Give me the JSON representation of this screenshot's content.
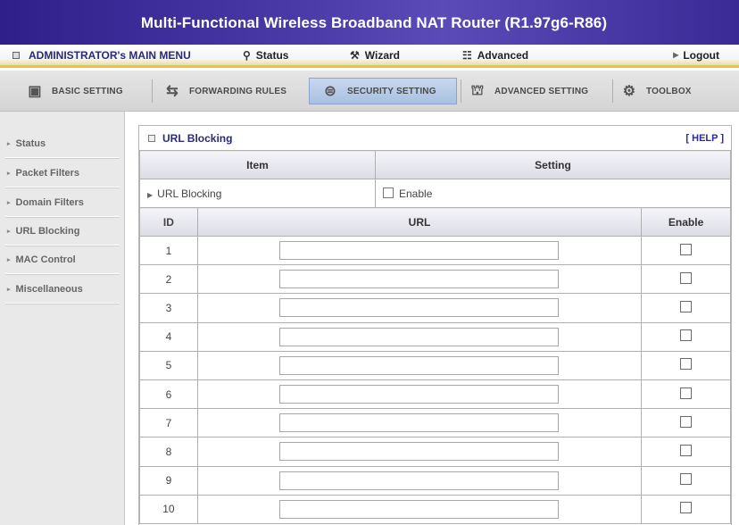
{
  "header": {
    "title": "Multi-Functional Wireless Broadband NAT Router (R1.97g6-R86)"
  },
  "main_menu": {
    "admin_label": "ADMINISTRATOR's MAIN MENU",
    "status_label": "Status",
    "wizard_label": "Wizard",
    "advanced_label": "Advanced",
    "logout_label": "Logout"
  },
  "tabs": {
    "basic": "BASIC SETTING",
    "forwarding": "FORWARDING RULES",
    "security": "SECURITY SETTING",
    "advanced": "ADVANCED SETTING",
    "toolbox": "TOOLBOX"
  },
  "sidebar": {
    "items": [
      "Status",
      "Packet Filters",
      "Domain Filters",
      "URL Blocking",
      "MAC Control",
      "Miscellaneous"
    ]
  },
  "panel": {
    "title": "URL Blocking",
    "help": "[ HELP ]",
    "col_item": "Item",
    "col_setting": "Setting",
    "row_label": "URL Blocking",
    "enable_label": "Enable",
    "enable_checked": false
  },
  "url_table": {
    "col_id": "ID",
    "col_url": "URL",
    "col_enable": "Enable",
    "rows": [
      {
        "id": "1",
        "url": "",
        "enabled": false
      },
      {
        "id": "2",
        "url": "",
        "enabled": false
      },
      {
        "id": "3",
        "url": "",
        "enabled": false
      },
      {
        "id": "4",
        "url": "",
        "enabled": false
      },
      {
        "id": "5",
        "url": "",
        "enabled": false
      },
      {
        "id": "6",
        "url": "",
        "enabled": false
      },
      {
        "id": "7",
        "url": "",
        "enabled": false
      },
      {
        "id": "8",
        "url": "",
        "enabled": false
      },
      {
        "id": "9",
        "url": "",
        "enabled": false
      },
      {
        "id": "10",
        "url": "",
        "enabled": false
      }
    ]
  },
  "colors": {
    "title_bar": "#3a2a96",
    "menu_accent": "#f0c040",
    "active_tab": "#a8c0e0"
  }
}
